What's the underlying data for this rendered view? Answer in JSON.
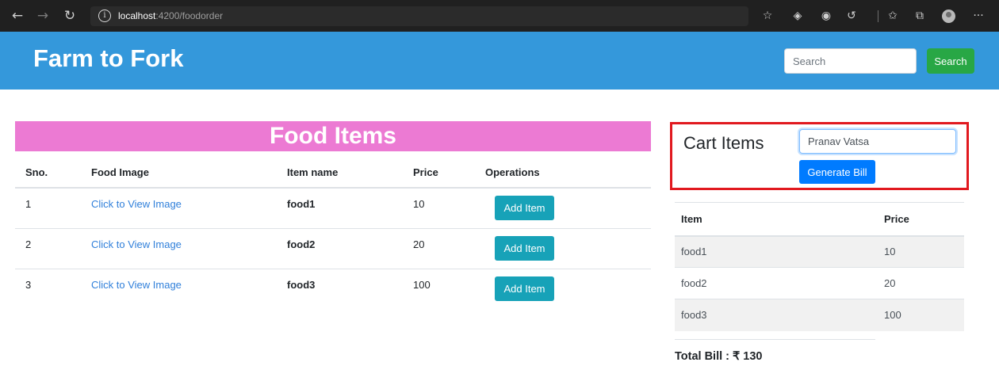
{
  "browser": {
    "url_host": "localhost",
    "url_path": ":4200/foodorder",
    "info_glyph": "i",
    "icons": {
      "back": "back-arrow-icon",
      "forward": "forward-arrow-icon",
      "reload": "reload-icon",
      "info": "info-icon",
      "favorite_add": "favorite-add-icon",
      "extensions": [
        "extension-icon",
        "record-icon",
        "refresh-extension-icon"
      ],
      "favorites": "favorites-icon",
      "collections": "collections-icon",
      "profile": "profile-avatar-icon",
      "menu": "more-menu-icon"
    }
  },
  "header": {
    "brand": "Farm to Fork",
    "search_placeholder": "Search",
    "search_button": "Search",
    "colors": {
      "bar": "#3498db",
      "button": "#28a745"
    }
  },
  "food": {
    "title": "Food Items",
    "title_color": "#ec7ad3",
    "columns": [
      "Sno.",
      "Food Image",
      "Item name",
      "Price",
      "Operations"
    ],
    "rows": [
      {
        "sno": "1",
        "image_link": "Click to View Image",
        "name": "food1",
        "price": "10",
        "action": "Add Item"
      },
      {
        "sno": "2",
        "image_link": "Click to View Image",
        "name": "food2",
        "price": "20",
        "action": "Add Item"
      },
      {
        "sno": "3",
        "image_link": "Click to View Image",
        "name": "food3",
        "price": "100",
        "action": "Add Item"
      }
    ]
  },
  "cart": {
    "title": "Cart Items",
    "customer_name": "Pranav Vatsa",
    "generate_button": "Generate Bill",
    "columns": [
      "Item",
      "Price"
    ],
    "rows": [
      {
        "item": "food1",
        "price": "10"
      },
      {
        "item": "food2",
        "price": "20"
      },
      {
        "item": "food3",
        "price": "100"
      }
    ],
    "total": "Total Bill : ₹ 130",
    "highlight_color": "#e1191f"
  }
}
